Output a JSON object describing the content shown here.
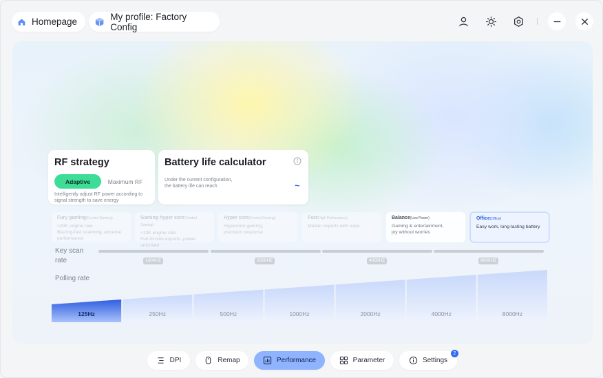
{
  "header": {
    "homepage_label": "Homepage",
    "profile_label": "My profile: Factory Config"
  },
  "rf": {
    "title": "RF strategy",
    "active_option": "Adaptive",
    "other_option": "Maximum RF",
    "description_1": "Intelligently adjust RF power according to",
    "description_2": "signal strength to save energy"
  },
  "battery": {
    "title": "Battery life calculator",
    "description_1": "Under the current configuration,",
    "description_2": "the battery life can reach",
    "value": "~"
  },
  "modes": [
    {
      "title": "Fury gaming",
      "tag": "(Corded Gaming)",
      "desc1": "≈20K engine rate",
      "desc2": "Blazing-fast scanning, extreme",
      "desc3": "performance"
    },
    {
      "title": "Gaming hyper core",
      "tag": "(Corded Gaming)",
      "desc1": "≈13K engine rate",
      "desc2": "Full-throttle esports, power",
      "desc3": "unlocked"
    },
    {
      "title": "Hyper core",
      "tag": "(Corded Gaming)",
      "desc1": "Hypercore gaming,",
      "desc2": "precision response",
      "desc3": ""
    },
    {
      "title": "Fast",
      "tag": "(High Performance)",
      "desc1": "Master esports with ease",
      "desc2": "",
      "desc3": ""
    },
    {
      "title": "Balance",
      "tag": "(Low Power)",
      "desc1": "Gaming & entertainment,",
      "desc2": "joy without worries",
      "desc3": ""
    },
    {
      "title": "Office",
      "tag": "(Office)",
      "desc1": "Easy work, long-lasting battery",
      "desc2": "",
      "desc3": ""
    }
  ],
  "key_scan": {
    "label_1": "Key scan",
    "label_2": "rate",
    "ticks": [
      "1000HZ",
      "2000HZ",
      "4000HZ",
      "8000HZ"
    ]
  },
  "polling": {
    "label": "Polling rate",
    "rates": [
      "125Hz",
      "250Hz",
      "500Hz",
      "1000Hz",
      "2000Hz",
      "4000Hz",
      "8000Hz"
    ],
    "selected_index": 0
  },
  "nav": {
    "dpi": "DPI",
    "remap": "Remap",
    "performance": "Performance",
    "parameter": "Parameter",
    "settings": "Settings",
    "settings_badge": "2"
  },
  "colors": {
    "accent_green": "#3ddc97",
    "accent_blue": "#2f6cf0",
    "nav_active": "#8fb3ff"
  }
}
